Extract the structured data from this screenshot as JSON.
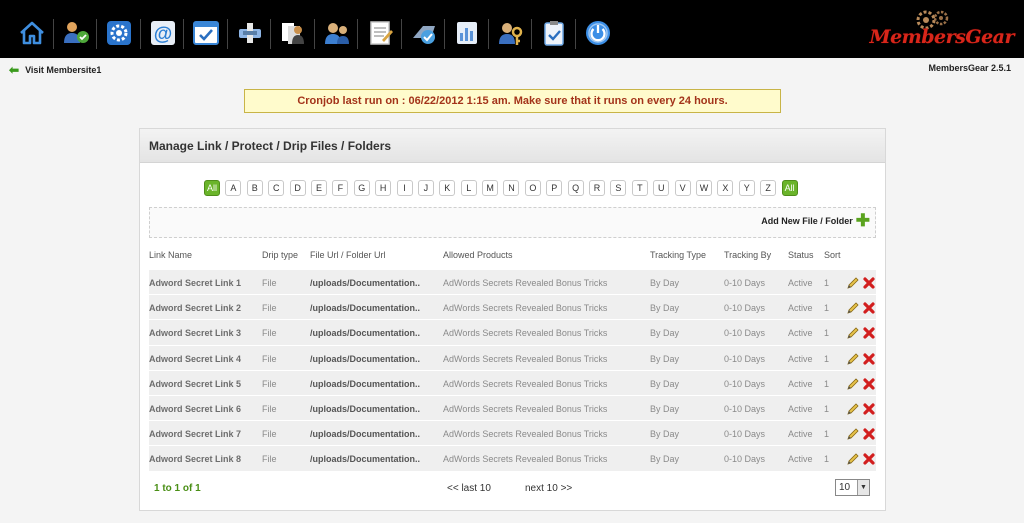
{
  "toolbar": {
    "icons": [
      {
        "name": "home-icon",
        "color": "#3f8fe0"
      },
      {
        "name": "members-icon",
        "color": "#e0a35c"
      },
      {
        "name": "settings-gear-icon",
        "color": "#2a74cc"
      },
      {
        "name": "email-at-icon",
        "color": "#2c7fd4"
      },
      {
        "name": "checklist-window-icon",
        "color": "#3a86d6"
      },
      {
        "name": "download-tool-icon",
        "color": "#8fb6e6"
      },
      {
        "name": "user-documents-icon",
        "color": "#c98f4a"
      },
      {
        "name": "user-group-icon",
        "color": "#3c7fd1"
      },
      {
        "name": "notepad-icon",
        "color": "#c9c9c9"
      },
      {
        "name": "stamp-check-icon",
        "color": "#4aa0e0"
      },
      {
        "name": "reports-chart-icon",
        "color": "#5a93d8"
      },
      {
        "name": "user-key-icon",
        "color": "#e0b24c"
      },
      {
        "name": "clipboard-check-icon",
        "color": "#6da8e6"
      },
      {
        "name": "power-icon",
        "color": "#3c8fe6"
      }
    ]
  },
  "brand": {
    "name": "MembersGear",
    "color": "#d8261a"
  },
  "header": {
    "back_label": "Visit Membersite1",
    "version": "MembersGear 2.5.1"
  },
  "notice": "Cronjob last run on : 06/22/2012 1:15 am. Make sure that it runs on every 24 hours.",
  "panel": {
    "title": "Manage Link / Protect / Drip Files / Folders",
    "alphabet": [
      "All",
      "A",
      "B",
      "C",
      "D",
      "E",
      "F",
      "G",
      "H",
      "I",
      "J",
      "K",
      "L",
      "M",
      "N",
      "O",
      "P",
      "Q",
      "R",
      "S",
      "T",
      "U",
      "V",
      "W",
      "X",
      "Y",
      "Z",
      "All"
    ],
    "add_label": "Add New File / Folder",
    "columns": [
      "Link Name",
      "Drip type",
      "File Url / Folder Url",
      "Allowed Products",
      "Tracking Type",
      "Tracking By",
      "Status",
      "Sort"
    ],
    "rows": [
      {
        "name": "Adword Secret Link 1",
        "drip": "File",
        "url": "/uploads/Documentation..",
        "products": "AdWords Secrets Revealed Bonus Tricks",
        "tracking_type": "By Day",
        "tracking_by": "0-10 Days",
        "status": "Active",
        "sort": "1"
      },
      {
        "name": "Adword Secret Link 2",
        "drip": "File",
        "url": "/uploads/Documentation..",
        "products": "AdWords Secrets Revealed Bonus Tricks",
        "tracking_type": "By Day",
        "tracking_by": "0-10 Days",
        "status": "Active",
        "sort": "1"
      },
      {
        "name": "Adword Secret Link 3",
        "drip": "File",
        "url": "/uploads/Documentation..",
        "products": "AdWords Secrets Revealed Bonus Tricks",
        "tracking_type": "By Day",
        "tracking_by": "0-10 Days",
        "status": "Active",
        "sort": "1"
      },
      {
        "name": "Adword Secret Link 4",
        "drip": "File",
        "url": "/uploads/Documentation..",
        "products": "AdWords Secrets Revealed Bonus Tricks",
        "tracking_type": "By Day",
        "tracking_by": "0-10 Days",
        "status": "Active",
        "sort": "1"
      },
      {
        "name": "Adword Secret Link 5",
        "drip": "File",
        "url": "/uploads/Documentation..",
        "products": "AdWords Secrets Revealed Bonus Tricks",
        "tracking_type": "By Day",
        "tracking_by": "0-10 Days",
        "status": "Active",
        "sort": "1"
      },
      {
        "name": "Adword Secret Link 6",
        "drip": "File",
        "url": "/uploads/Documentation..",
        "products": "AdWords Secrets Revealed Bonus Tricks",
        "tracking_type": "By Day",
        "tracking_by": "0-10 Days",
        "status": "Active",
        "sort": "1"
      },
      {
        "name": "Adword Secret Link 7",
        "drip": "File",
        "url": "/uploads/Documentation..",
        "products": "AdWords Secrets Revealed Bonus Tricks",
        "tracking_type": "By Day",
        "tracking_by": "0-10 Days",
        "status": "Active",
        "sort": "1"
      },
      {
        "name": "Adword Secret Link 8",
        "drip": "File",
        "url": "/uploads/Documentation..",
        "products": "AdWords Secrets Revealed Bonus Tricks",
        "tracking_type": "By Day",
        "tracking_by": "0-10 Days",
        "status": "Active",
        "sort": "1"
      }
    ],
    "pager": {
      "count": "1 to 1 of 1",
      "prev": "<< last 10",
      "next": "next 10 >>",
      "per_page": "10"
    }
  }
}
